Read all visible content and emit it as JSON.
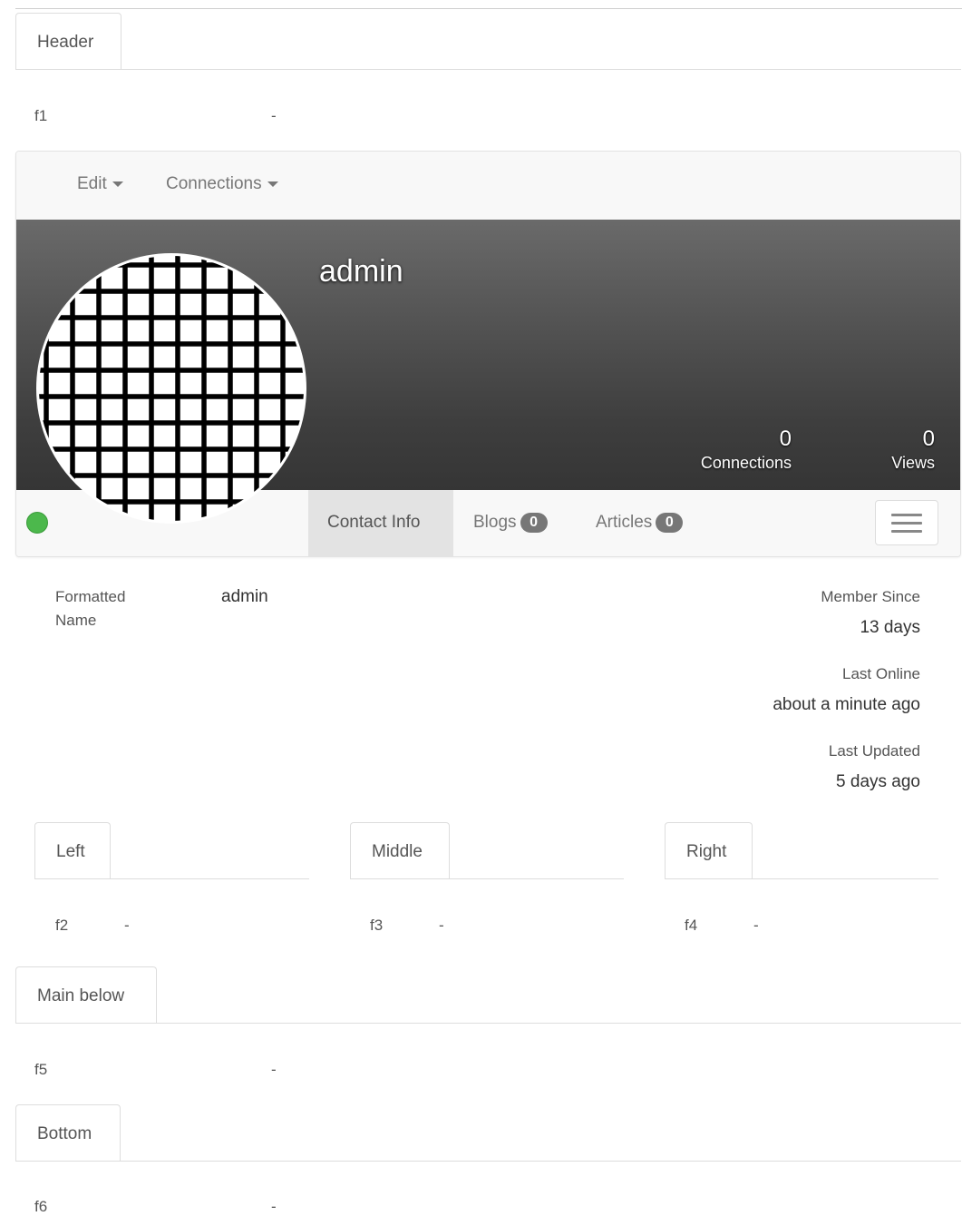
{
  "sections": {
    "header": {
      "tab": "Header",
      "field": "f1",
      "value": "-"
    },
    "left": {
      "tab": "Left",
      "field": "f2",
      "value": "-"
    },
    "middle": {
      "tab": "Middle",
      "field": "f3",
      "value": "-"
    },
    "right": {
      "tab": "Right",
      "field": "f4",
      "value": "-"
    },
    "main_below": {
      "tab": "Main below",
      "field": "f5",
      "value": "-"
    },
    "bottom": {
      "tab": "Bottom",
      "field": "f6",
      "value": "-"
    }
  },
  "profile": {
    "nav": {
      "edit": "Edit",
      "connections": "Connections"
    },
    "name": "admin",
    "stats": {
      "connections": {
        "value": "0",
        "label": "Connections"
      },
      "views": {
        "value": "0",
        "label": "Views"
      }
    },
    "status_color": "#4cb84c",
    "tabs": {
      "contact_info": "Contact Info",
      "blogs": "Blogs",
      "blogs_count": "0",
      "articles": "Articles",
      "articles_count": "0"
    },
    "menu_icon": "hamburger-icon",
    "avatar_icon": "grid-pattern-avatar"
  },
  "contact_info": {
    "formatted_name_label": "Formatted Name",
    "formatted_name_value": "admin",
    "member_since_label": "Member Since",
    "member_since_value": "13 days",
    "last_online_label": "Last Online",
    "last_online_value": "about a minute ago",
    "last_updated_label": "Last Updated",
    "last_updated_value": "5 days ago"
  }
}
